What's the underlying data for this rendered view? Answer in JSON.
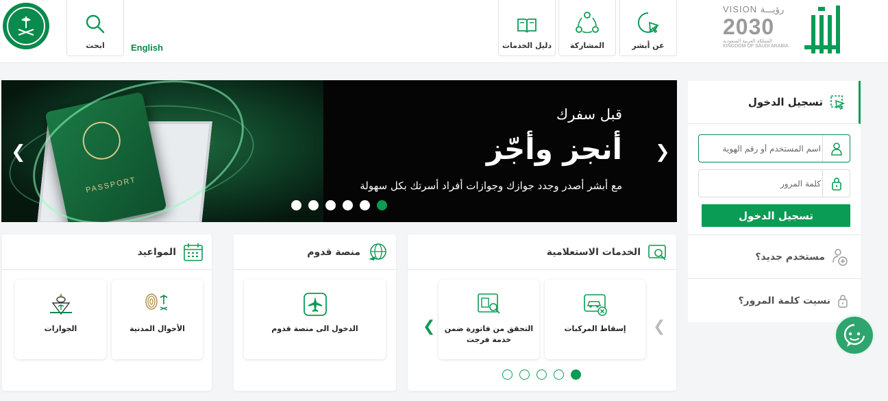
{
  "header": {
    "english_label": "English",
    "search_label": "ابحث",
    "nav": [
      {
        "label": "دليل الخدمات",
        "icon": "book-icon"
      },
      {
        "label": "المشاركة",
        "icon": "share-network-icon"
      },
      {
        "label": "عن أبشر",
        "icon": "chat-pointer-icon"
      }
    ],
    "vision": {
      "line1": "VISION",
      "arabic": "رؤيـــة",
      "year": "2030",
      "kingdom_ar": "المملكة العربية السعودية",
      "kingdom_en": "KINGDOM OF SAUDI ARABIA"
    },
    "brand_color": "#0a9b54"
  },
  "banner": {
    "line1": "قبل سفرك",
    "line2": "أنجز وأجّز",
    "line3": "مع أبشر أصدر وجدد جوازك وجوازات أفراد أسرتك بكل سهولة",
    "passport_text": "PASSPORT",
    "slides_total": 6,
    "active_slide": 6
  },
  "login": {
    "title": "تسجيل الدخول",
    "username_placeholder": "اسم المستخدم أو رقم الهوية",
    "password_placeholder": "كلمة المرور",
    "submit_label": "تسجيل الدخول",
    "new_user": "مستخدم جديد؟",
    "forgot_password": "نسيت كلمة المرور؟"
  },
  "cards": {
    "inquiry": {
      "title": "الخدمات الاستعلامية",
      "tiles": [
        "إسقاط المركبات",
        "التحقق من فاتورة ضمن خدمة فرجت"
      ],
      "pages_total": 5,
      "active_page": 1
    },
    "arrival": {
      "title": "منصة قدوم",
      "tiles": [
        "الدخول الى منصة قدوم"
      ]
    },
    "appointments": {
      "title": "المواعيد",
      "tiles": [
        "الأحوال المدنية",
        "الجوازات"
      ],
      "civil_logo_text": "الأحوال المدنية"
    }
  }
}
